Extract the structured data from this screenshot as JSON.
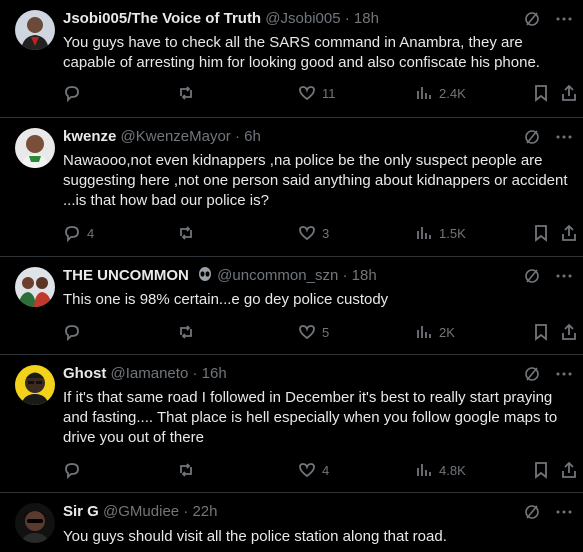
{
  "tweets": [
    {
      "name": "Jsobi005/The Voice of Truth",
      "handle": "@Jsobi005",
      "dot": "·",
      "time": "18h",
      "text": "You guys have to check all the SARS command in Anambra, they are capable of arresting him for looking good and also confiscate his phone.",
      "replies": "",
      "retweets": "",
      "likes": "11",
      "views": "2.4K"
    },
    {
      "name": "kwenze",
      "handle": "@KwenzeMayor",
      "dot": "·",
      "time": "6h",
      "text": "Nawaooo,not even kidnappers ,na police be the only suspect people are suggesting here ,not one person said anything about kidnappers or accident ...is that how bad our police is?",
      "replies": "4",
      "retweets": "",
      "likes": "3",
      "views": "1.5K"
    },
    {
      "name": "THE UNCOMMON",
      "handle": "@uncommon_szn",
      "dot": "·",
      "time": "18h",
      "text": "This one is 98% certain...e go dey police custody",
      "replies": "",
      "retweets": "",
      "likes": "5",
      "views": "2K"
    },
    {
      "name": "Ghost",
      "handle": "@Iamaneto",
      "dot": "·",
      "time": "16h",
      "text": "If it's that same road I followed in December it's best to really start praying and fasting.... That place is hell especially when you follow google maps to drive you out of there",
      "replies": "",
      "retweets": "",
      "likes": "4",
      "views": "4.8K"
    },
    {
      "name": "Sir G",
      "handle": "@GMudiee",
      "dot": "·",
      "time": "22h",
      "text": "You guys should visit all the police station along that road."
    }
  ]
}
